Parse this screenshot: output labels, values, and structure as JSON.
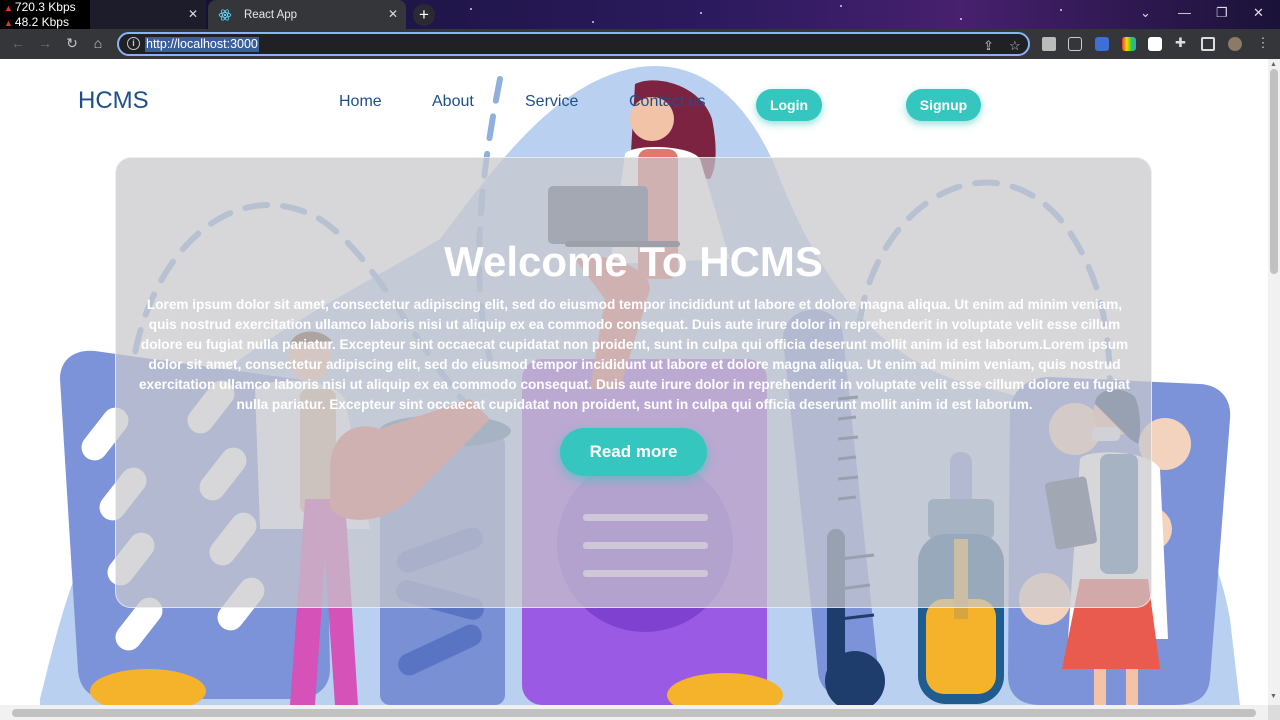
{
  "netstat": {
    "down": "720.3 Kbps",
    "up": "48.2 Kbps"
  },
  "tabs": [
    {
      "label": "",
      "active": false
    },
    {
      "label": "React App",
      "active": true
    }
  ],
  "address_bar": {
    "url": "http://localhost:3000"
  },
  "nav": {
    "brand": "HCMS",
    "links": [
      "Home",
      "About",
      "Service",
      "Contact us"
    ],
    "login": "Login",
    "signup": "Signup"
  },
  "hero": {
    "title": "Welcome To HCMS",
    "text": "Lorem ipsum dolor sit amet, consectetur adipiscing elit, sed do eiusmod tempor incididunt ut labore et dolore magna aliqua. Ut enim ad minim veniam, quis nostrud exercitation ullamco laboris nisi ut aliquip ex ea commodo consequat. Duis aute irure dolor in reprehenderit in voluptate velit esse cillum dolore eu fugiat nulla pariatur. Excepteur sint occaecat cupidatat non proident, sunt in culpa qui officia deserunt mollit anim id est laborum.Lorem ipsum dolor sit amet, consectetur adipiscing elit, sed do eiusmod tempor incididunt ut labore et dolore magna aliqua. Ut enim ad minim veniam, quis nostrud exercitation ullamco laboris nisi ut aliquip ex ea commodo consequat. Duis aute irure dolor in reprehenderit in voluptate velit esse cillum dolore eu fugiat nulla pariatur. Excepteur sint occaecat cupidatat non proident, sunt in culpa qui officia deserunt mollit anim id est laborum.",
    "button": "Read more"
  },
  "colors": {
    "accent": "#35c6c0",
    "brand": "#1d4f8c"
  }
}
